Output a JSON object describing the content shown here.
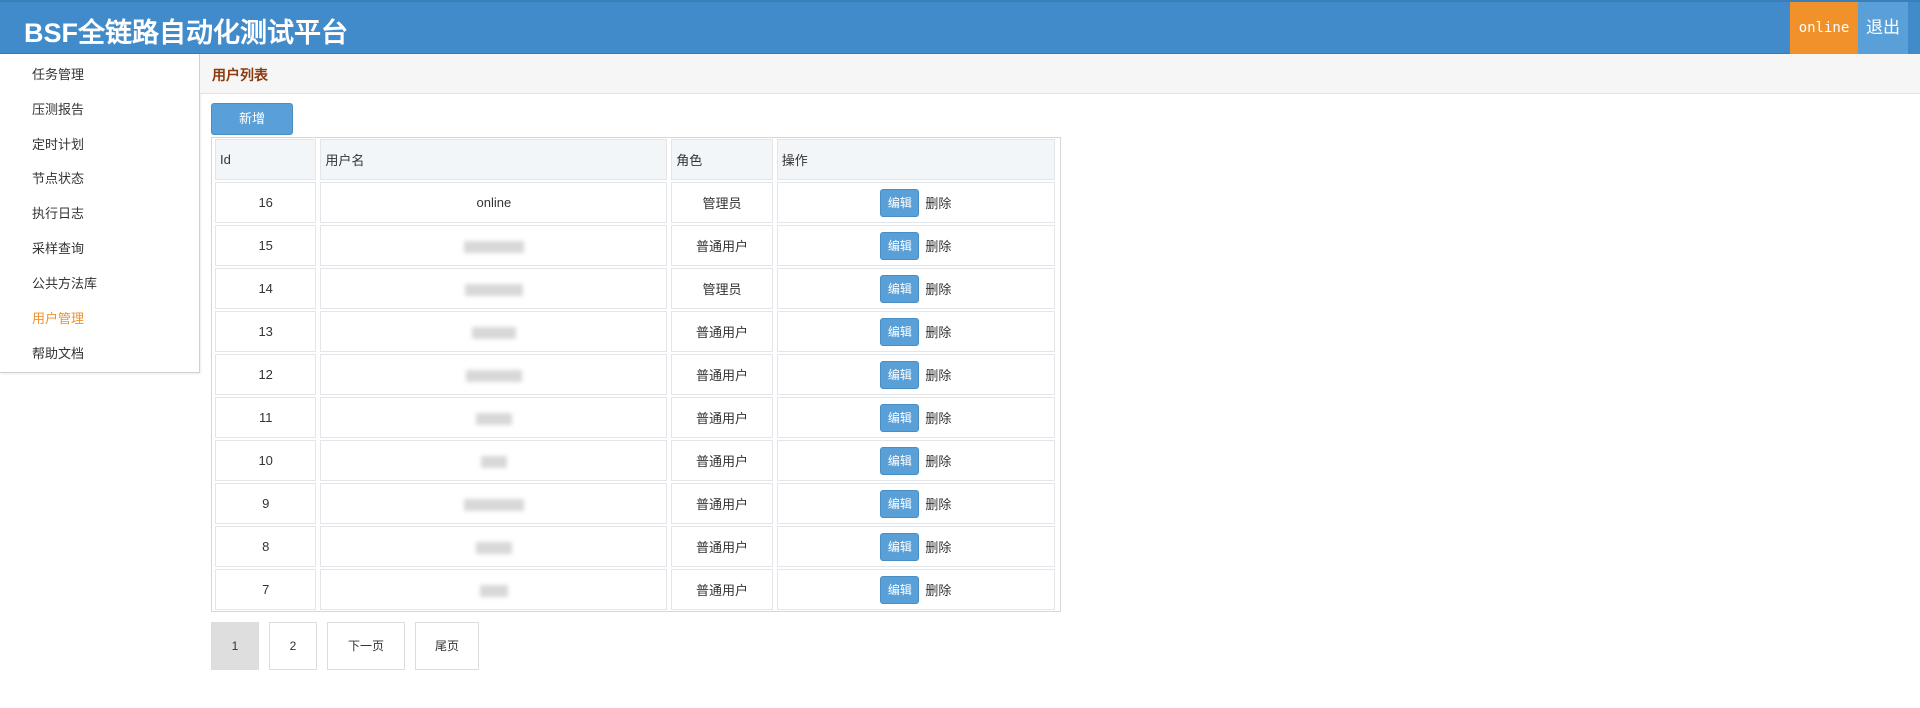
{
  "app": {
    "title": "BSF全链路自动化测试平台",
    "user": "online",
    "logout_label": "退出"
  },
  "sidebar": {
    "items": [
      {
        "label": "任务管理"
      },
      {
        "label": "压测报告"
      },
      {
        "label": "定时计划"
      },
      {
        "label": "节点状态"
      },
      {
        "label": "执行日志"
      },
      {
        "label": "采样查询"
      },
      {
        "label": "公共方法库"
      },
      {
        "label": "用户管理",
        "active": true
      },
      {
        "label": "帮助文档"
      }
    ]
  },
  "main": {
    "section_title": "用户列表",
    "add_label": "新增",
    "table": {
      "headers": [
        "Id",
        "用户名",
        "角色",
        "操作"
      ],
      "edit_label": "编辑",
      "delete_label": "删除",
      "rows": [
        {
          "id": "16",
          "username": "online",
          "role": "管理员"
        },
        {
          "id": "15",
          "username": "",
          "role": "普通用户"
        },
        {
          "id": "14",
          "username": "",
          "role": "管理员"
        },
        {
          "id": "13",
          "username": "",
          "role": "普通用户"
        },
        {
          "id": "12",
          "username": "",
          "role": "普通用户"
        },
        {
          "id": "11",
          "username": "",
          "role": "普通用户"
        },
        {
          "id": "10",
          "username": "",
          "role": "普通用户"
        },
        {
          "id": "9",
          "username": "",
          "role": "普通用户"
        },
        {
          "id": "8",
          "username": "",
          "role": "普通用户"
        },
        {
          "id": "7",
          "username": "",
          "role": "普通用户"
        }
      ]
    },
    "pagination": {
      "pages": [
        "1",
        "2"
      ],
      "current": "1",
      "next_label": "下一页",
      "last_label": "尾页"
    }
  },
  "colors": {
    "header": "#428bca",
    "accent": "#f0912a",
    "button": "#5aa0d8"
  }
}
